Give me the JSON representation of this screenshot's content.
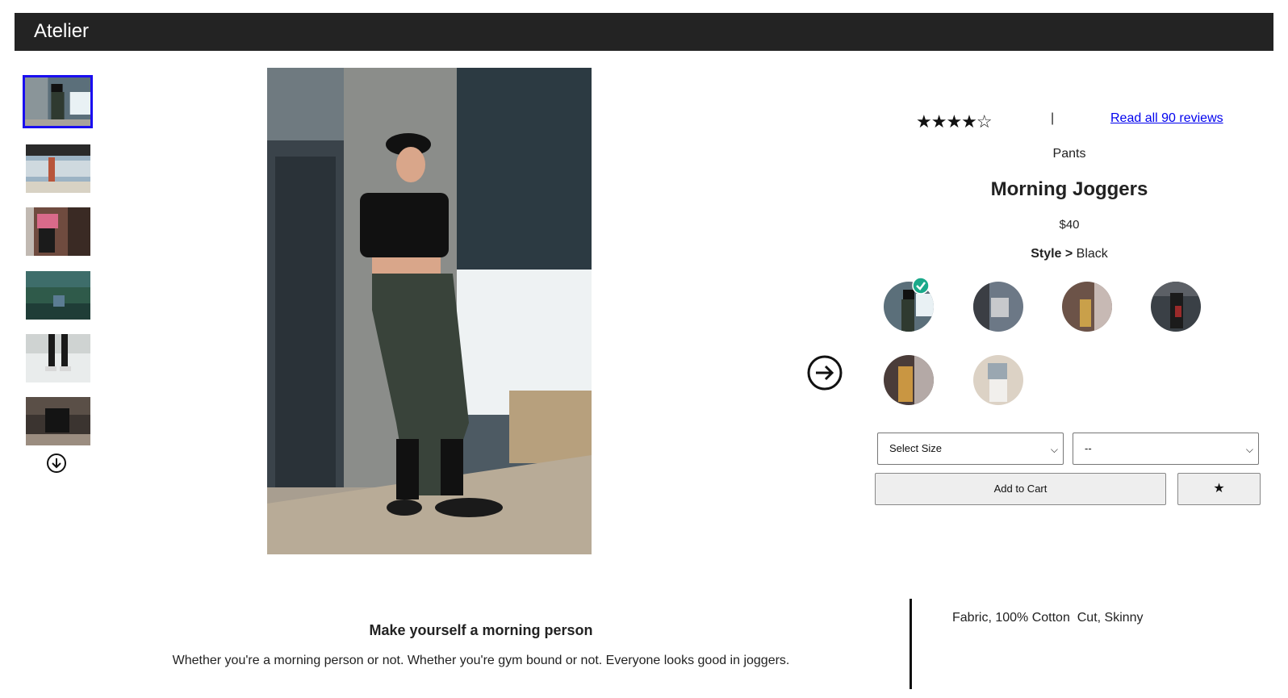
{
  "header": {
    "brand": "Atelier"
  },
  "gallery": {
    "thumbnails": [
      {
        "name": "thumbnail-1",
        "selected": true
      },
      {
        "name": "thumbnail-2",
        "selected": false
      },
      {
        "name": "thumbnail-3",
        "selected": false
      },
      {
        "name": "thumbnail-4",
        "selected": false
      },
      {
        "name": "thumbnail-5",
        "selected": false
      },
      {
        "name": "thumbnail-6",
        "selected": false
      }
    ],
    "scroll_icon": "arrow-down-circle-icon",
    "next_icon": "arrow-right-circle-icon"
  },
  "product": {
    "rating_stars": "★★★★☆",
    "rating_value": 4,
    "rating_separator": "|",
    "reviews_link": "Read all 90 reviews",
    "category": "Pants",
    "name": "Morning Joggers",
    "price": "$40",
    "style_label": "Style >",
    "style_value": "Black",
    "styles": [
      "Black",
      "Style 2",
      "Style 3",
      "Style 4",
      "Style 5",
      "Style 6"
    ],
    "selected_style_icon": "check-circle-icon"
  },
  "purchase": {
    "size_select": "Select Size",
    "quantity_select": "--",
    "add_to_cart": "Add to Cart",
    "favorite": "★"
  },
  "description": {
    "heading": "Make yourself a morning person",
    "body": "Whether you're a morning person or not. Whether you're gym bound or not. Everyone looks good in joggers.",
    "features": "Fabric, 100% Cotton  Cut, Skinny"
  },
  "colors": {
    "header_bg": "#232323",
    "selected_border": "#1a0ef0",
    "link": "#0000ee",
    "check": "#1aa98a"
  }
}
